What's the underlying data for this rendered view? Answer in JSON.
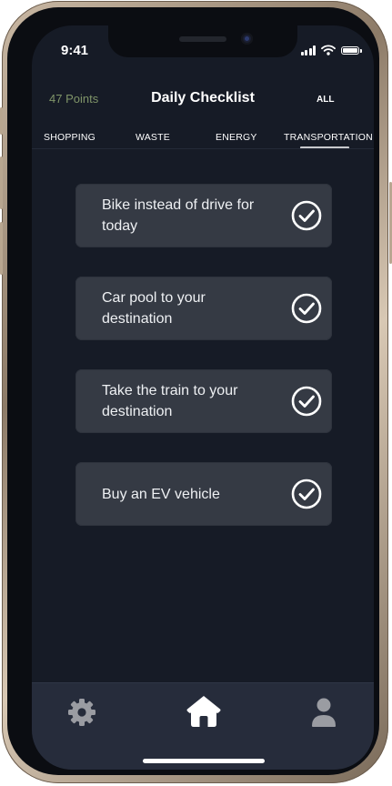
{
  "status_bar": {
    "time": "9:41"
  },
  "header": {
    "points": "47 Points",
    "title": "Daily Checklist",
    "all_label": "ALL"
  },
  "tabs": [
    {
      "label": "SHOPPING"
    },
    {
      "label": "WASTE"
    },
    {
      "label": "ENERGY"
    },
    {
      "label": "TRANSPORTATION",
      "selected": true
    }
  ],
  "checklist": [
    {
      "text": "Bike instead of drive for today",
      "icon": "check-circle-icon"
    },
    {
      "text": "Car pool to your destination",
      "icon": "check-circle-icon"
    },
    {
      "text": "Take the train to your destination",
      "icon": "check-circle-icon"
    },
    {
      "text": "Buy an EV vehicle",
      "icon": "check-circle-icon"
    }
  ],
  "bottom_nav": [
    {
      "icon": "gear-icon"
    },
    {
      "icon": "home-icon",
      "active": true
    },
    {
      "icon": "user-icon"
    }
  ],
  "colors": {
    "screen_background": "#161b26",
    "card_background": "#353a44",
    "points_text": "#7f9468",
    "bottom_bar": "#262c3b"
  }
}
